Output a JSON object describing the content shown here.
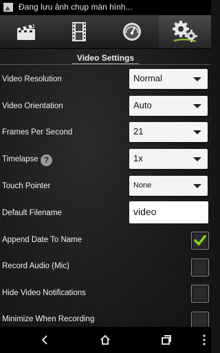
{
  "status_bar": {
    "notification_icon": "image-icon",
    "notification_text": "Đang lưu ảnh chụp màn hình..."
  },
  "tabs": [
    {
      "name": "clapperboard-icon",
      "active": false
    },
    {
      "name": "film-strip-icon",
      "active": false
    },
    {
      "name": "speedometer-icon",
      "active": false
    },
    {
      "name": "gears-icon",
      "active": true
    }
  ],
  "section": {
    "title": "Video Settings"
  },
  "settings": {
    "video_resolution": {
      "label": "Video Resolution",
      "value": "Normal"
    },
    "video_orientation": {
      "label": "Video Orientation",
      "value": "Auto"
    },
    "frames_per_second": {
      "label": "Frames Per Second",
      "value": "21"
    },
    "timelapse": {
      "label": "Timelapse",
      "value": "1x",
      "help": "?"
    },
    "touch_pointer": {
      "label": "Touch Pointer",
      "value": "None"
    },
    "default_filename": {
      "label": "Default Filename",
      "value": "video"
    },
    "append_date": {
      "label": "Append Date To Name",
      "checked": true
    },
    "record_audio": {
      "label": "Record Audio (Mic)",
      "checked": false
    },
    "hide_notifications": {
      "label": "Hide Video Notifications",
      "checked": false
    },
    "minimize_recording": {
      "label": "Minimize When Recording",
      "checked": false
    }
  },
  "colors": {
    "check": "#7ed321",
    "accent": "#f4f4f4"
  },
  "nav": [
    "back-icon",
    "home-icon",
    "recent-apps-icon",
    "more-icon"
  ]
}
